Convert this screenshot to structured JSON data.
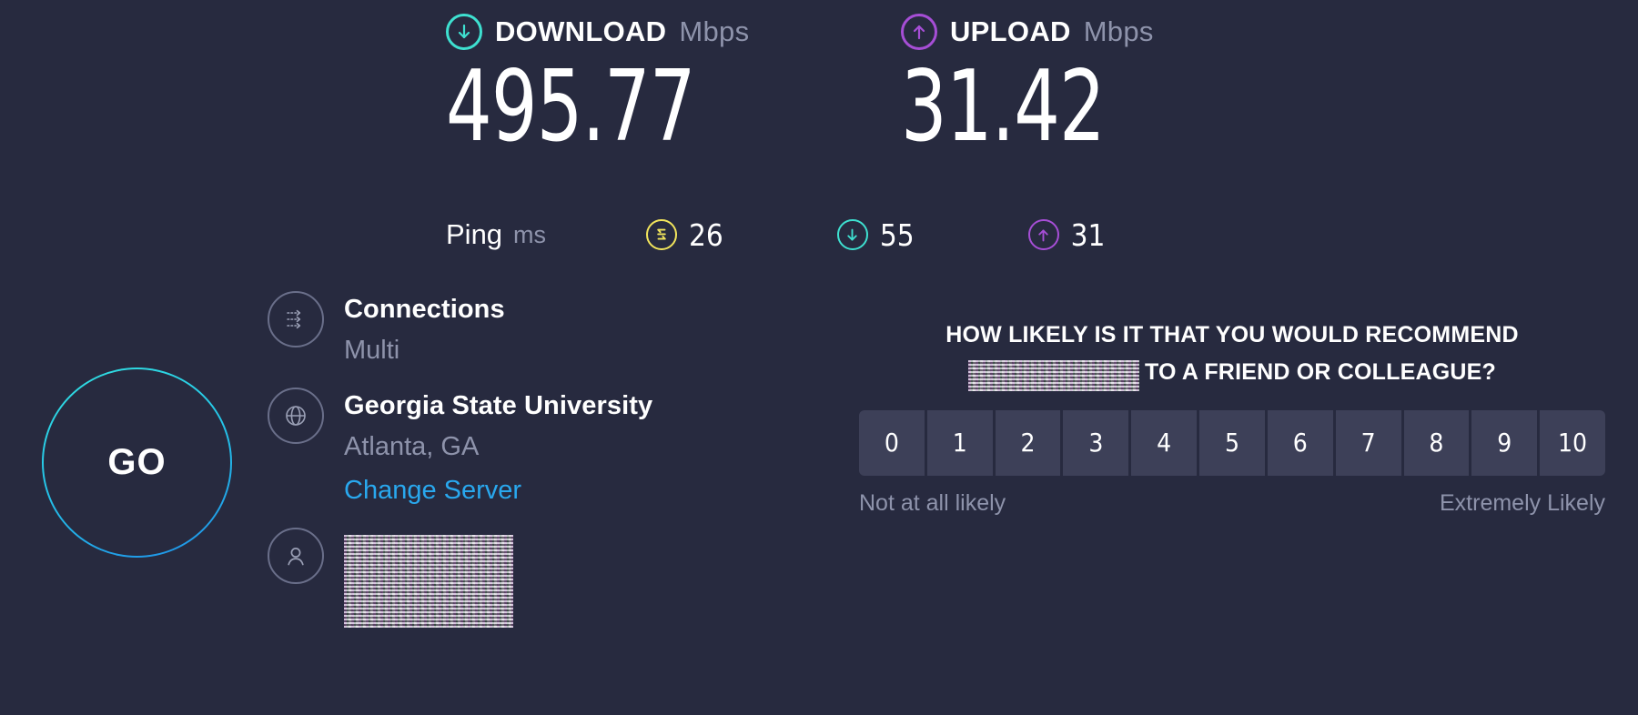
{
  "background_color": "#272a3f",
  "results": {
    "download": {
      "title": "DOWNLOAD",
      "unit": "Mbps",
      "value": "495.77",
      "icon": "download-arrow-circle-icon",
      "color": "#3ee0d0"
    },
    "upload": {
      "title": "UPLOAD",
      "unit": "Mbps",
      "value": "31.42",
      "icon": "upload-arrow-circle-icon",
      "color": "#a64ed6"
    },
    "ping": {
      "label": "Ping",
      "unit": "ms",
      "idle": {
        "value": "26",
        "icon": "idle-latency-icon",
        "color": "#f2e55c"
      },
      "download": {
        "value": "55",
        "icon": "download-arrow-circle-icon",
        "color": "#3ee0d0"
      },
      "upload": {
        "value": "31",
        "icon": "upload-arrow-circle-icon",
        "color": "#a64ed6"
      }
    }
  },
  "go_button": {
    "label": "GO",
    "ring_color_start": "#32e0e0",
    "ring_color_end": "#1f8fe8"
  },
  "info": {
    "connections": {
      "icon": "connections-multi-arrows-icon",
      "primary": "Connections",
      "secondary": "Multi"
    },
    "server": {
      "icon": "globe-icon",
      "primary": "Georgia State University",
      "secondary": "Atlanta, GA",
      "link": "Change Server",
      "link_color": "#29a8ee"
    },
    "isp": {
      "icon": "person-icon",
      "name_redacted": true
    }
  },
  "survey": {
    "question_part1": "HOW LIKELY IS IT THAT YOU WOULD RECOMMEND",
    "question_part2": "TO A FRIEND OR COLLEAGUE?",
    "brand_redacted": true,
    "ratings": [
      "0",
      "1",
      "2",
      "3",
      "4",
      "5",
      "6",
      "7",
      "8",
      "9",
      "10"
    ],
    "low_label": "Not at all likely",
    "high_label": "Extremely Likely",
    "cell_color": "#3d4058"
  }
}
